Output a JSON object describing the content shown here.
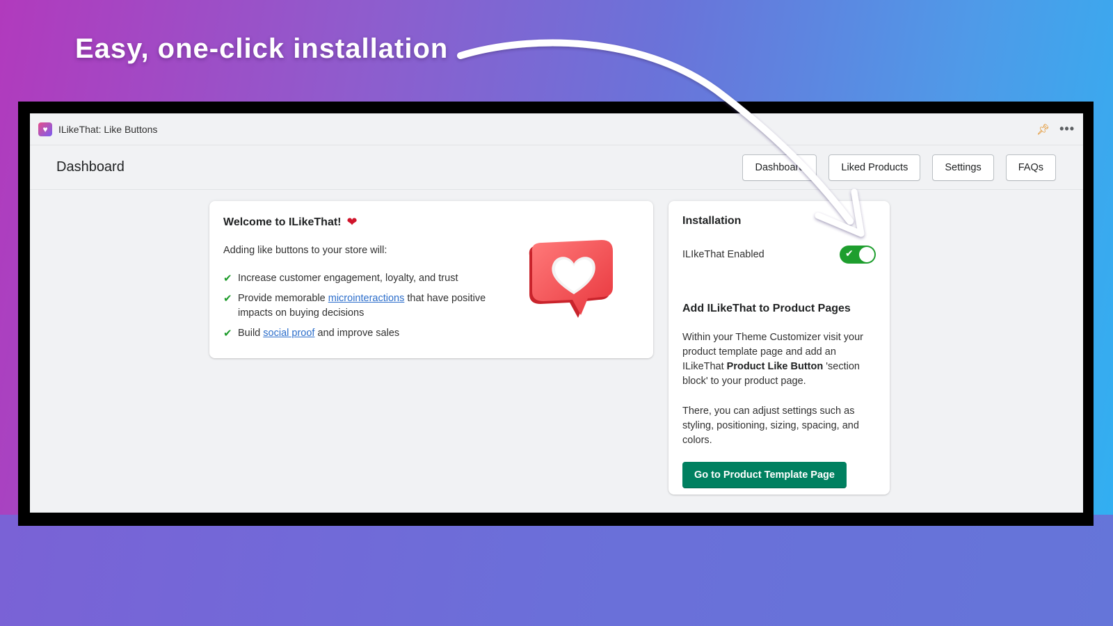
{
  "headline": "Easy, one-click installation",
  "app": {
    "name": "ILikeThat: Like Buttons",
    "icon": "heart-chat-icon",
    "titlebar_icons": [
      "pin-icon",
      "more-icon"
    ]
  },
  "header": {
    "title": "Dashboard",
    "nav": [
      {
        "label": "Dashboard"
      },
      {
        "label": "Liked Products"
      },
      {
        "label": "Settings"
      },
      {
        "label": "FAQs"
      }
    ]
  },
  "welcome": {
    "title": "Welcome to ILikeThat!",
    "intro": "Adding like buttons to your store will:",
    "benefits": [
      {
        "before": "Increase customer engagement, loyalty, and trust",
        "link": "",
        "after": ""
      },
      {
        "before": "Provide memorable ",
        "link": "microinteractions",
        "after": " that have positive impacts on buying decisions"
      },
      {
        "before": "Build ",
        "link": "social proof",
        "after": " and improve sales"
      }
    ]
  },
  "installation": {
    "title": "Installation",
    "toggle_label": "ILIkeThat Enabled",
    "toggle_on": true,
    "subtitle": "Add ILikeThat to Product Pages",
    "para1_a": "Within your Theme Customizer visit your product template page and add an ILikeThat ",
    "para1_bold": "Product Like Button",
    "para1_b": " 'section block' to your product page.",
    "para2": "There, you can adjust settings such as styling, positioning, sizing, spacing, and colors.",
    "button": "Go to Product Template Page"
  },
  "colors": {
    "primary": "#008060",
    "toggle_on": "#1e9e2e",
    "link": "#2c6ecb"
  }
}
